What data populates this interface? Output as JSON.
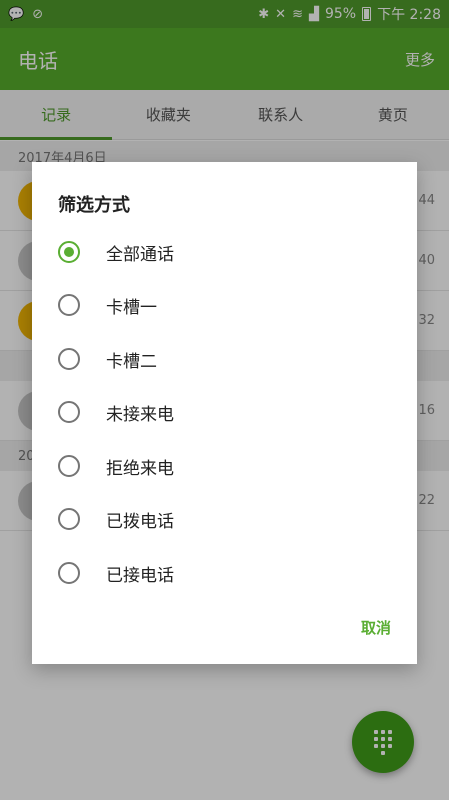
{
  "status_bar": {
    "left_icons": [
      "message-icon",
      "no-disturb-icon"
    ],
    "battery": "95%",
    "time": "下午 2:28"
  },
  "app_bar": {
    "title": "电话",
    "more_label": "更多"
  },
  "tabs": [
    {
      "label": "记录",
      "active": true
    },
    {
      "label": "收藏夹",
      "active": false
    },
    {
      "label": "联系人",
      "active": false
    },
    {
      "label": "黄页",
      "active": false
    }
  ],
  "call_log": {
    "date_header": "2017年4月6日",
    "rows_time_fragments": [
      "44",
      "40",
      "32",
      "16",
      "22"
    ],
    "second_date_header_fragment": "20"
  },
  "dialog": {
    "title": "筛选方式",
    "options": [
      {
        "label": "全部通话",
        "selected": true
      },
      {
        "label": "卡槽一",
        "selected": false
      },
      {
        "label": "卡槽二",
        "selected": false
      },
      {
        "label": "未接来电",
        "selected": false
      },
      {
        "label": "拒绝来电",
        "selected": false
      },
      {
        "label": "已拨电话",
        "selected": false
      },
      {
        "label": "已接电话",
        "selected": false
      }
    ],
    "cancel_label": "取消"
  },
  "colors": {
    "primary": "#57ac2c",
    "accent": "#5aae33",
    "fab": "#3f9c19"
  }
}
